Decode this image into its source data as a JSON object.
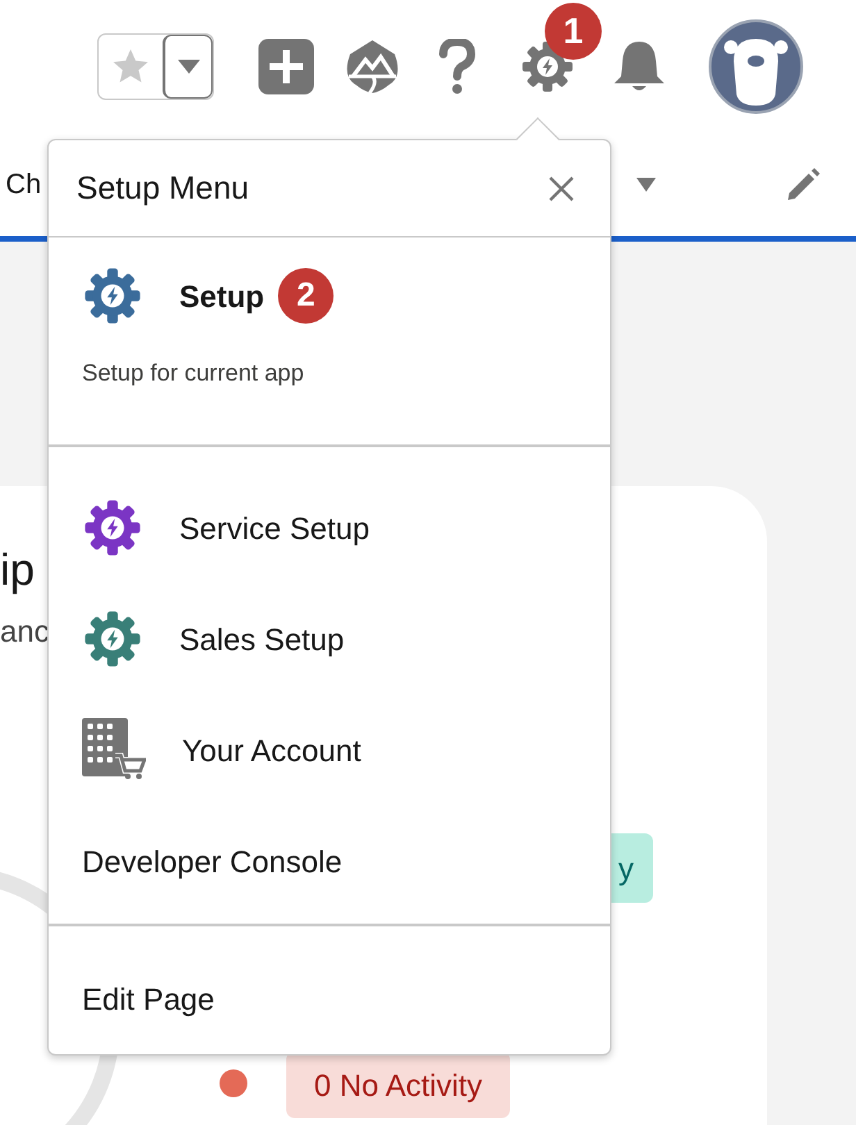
{
  "header": {
    "notification_badge": "1"
  },
  "tab_bar": {
    "tab": "Ch"
  },
  "page": {
    "title": "ip",
    "subtitle": "anc",
    "status_badge": "y",
    "activity_badge": "0 No Activity"
  },
  "setup_menu": {
    "title": "Setup Menu",
    "sections": [
      {
        "items": [
          {
            "kind": "gear",
            "label": "Setup",
            "color": "#3b6c9b",
            "bold": true,
            "badge": "2"
          }
        ],
        "description": "Setup for current app"
      },
      {
        "items": [
          {
            "kind": "gear",
            "label": "Service Setup",
            "color": "#7b35c4",
            "bold": false
          },
          {
            "kind": "gear",
            "label": "Sales Setup",
            "color": "#397f78",
            "bold": false
          },
          {
            "kind": "account",
            "label": "Your Account",
            "bold": false
          },
          {
            "kind": "text",
            "label": "Developer Console",
            "bold": false
          }
        ]
      },
      {
        "items": [
          {
            "kind": "text",
            "label": "Edit Page",
            "bold": false
          }
        ]
      }
    ]
  }
}
